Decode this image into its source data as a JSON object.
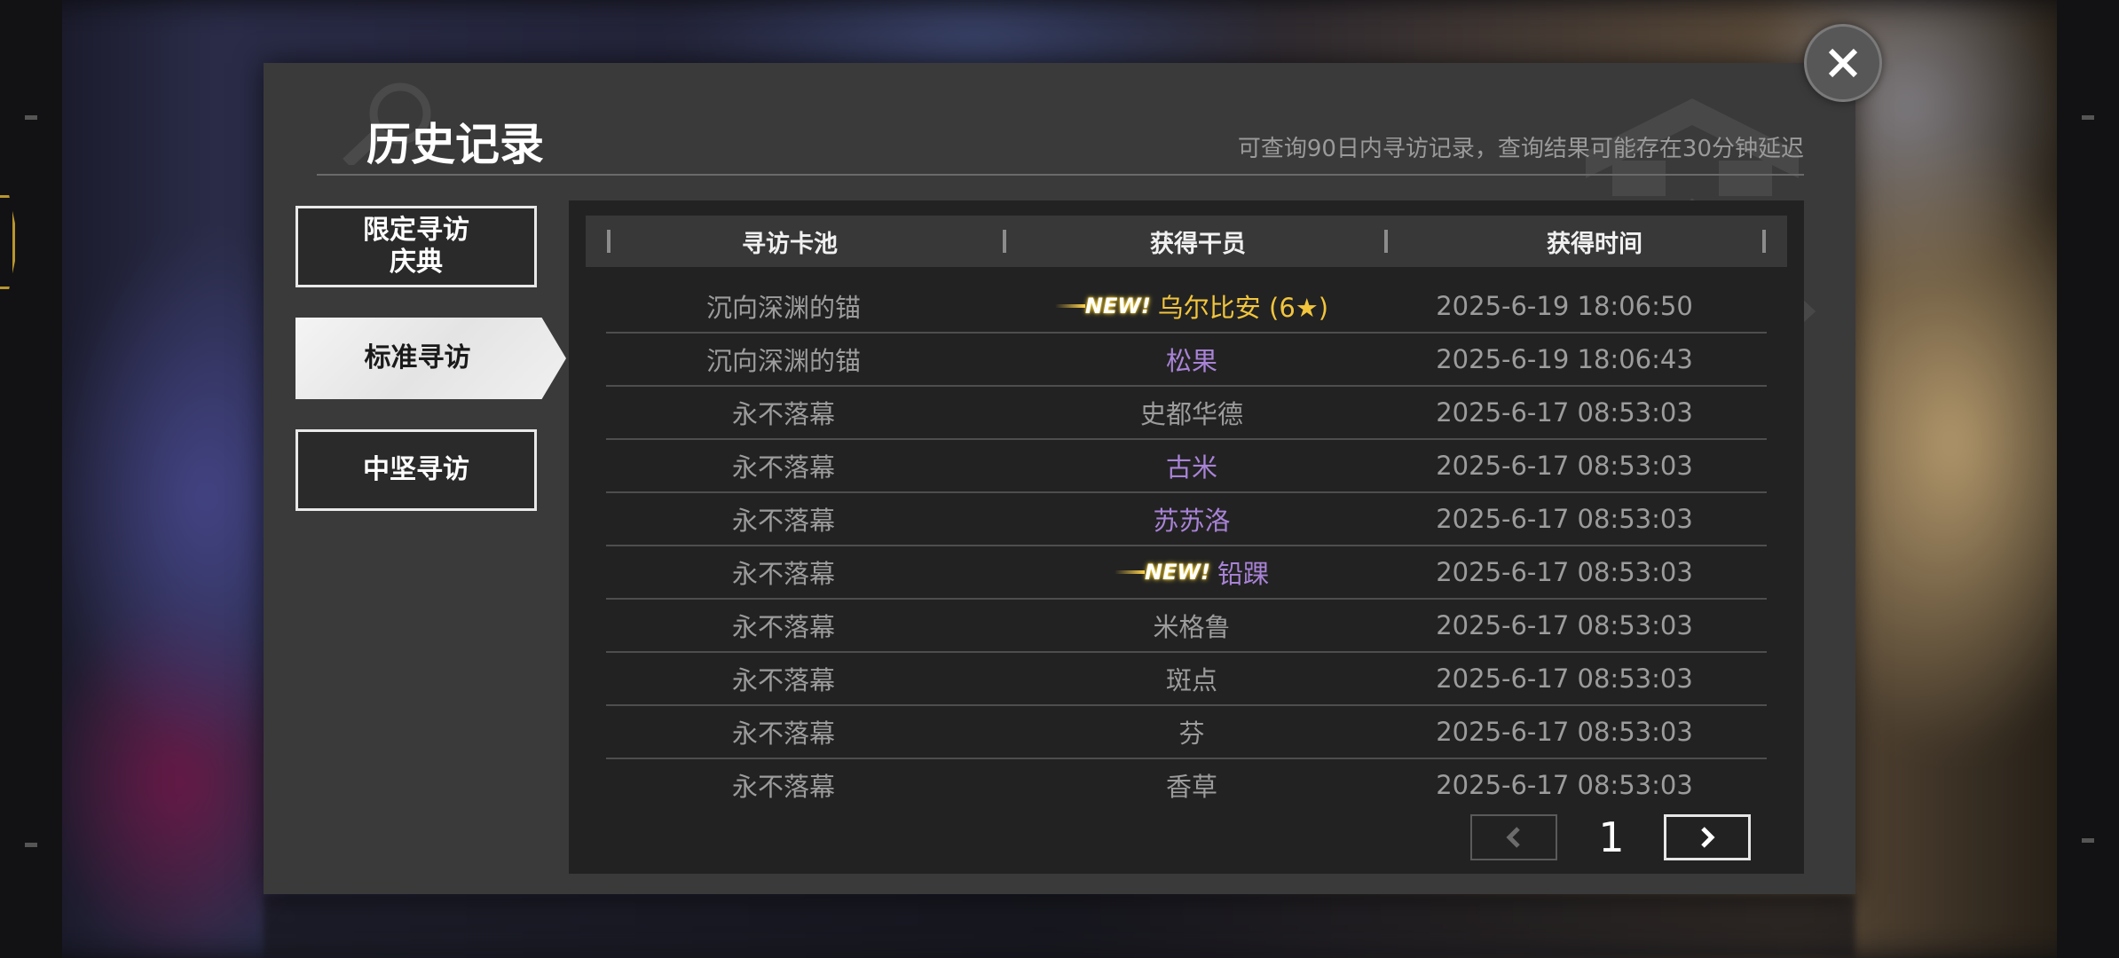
{
  "dialog": {
    "title": "历史记录",
    "subtitle": "可查询90日内寻访记录，查询结果可能存在30分钟延迟"
  },
  "tabs": [
    {
      "label": "限定寻访\n庆典",
      "active": false
    },
    {
      "label": "标准寻访",
      "active": true
    },
    {
      "label": "中坚寻访",
      "active": false
    }
  ],
  "table": {
    "headers": [
      "寻访卡池",
      "获得干员",
      "获得时间"
    ],
    "rows": [
      {
        "pool": "沉向深渊的锚",
        "operator": "乌尔比安 (6★)",
        "time": "2025-6-19 18:06:50",
        "new": true,
        "rarity": "six",
        "color": "#f2c53d"
      },
      {
        "pool": "沉向深渊的锚",
        "operator": "松果",
        "time": "2025-6-19 18:06:43",
        "new": false,
        "rarity": "four",
        "color": "#a883d6"
      },
      {
        "pool": "永不落幕",
        "operator": "史都华德",
        "time": "2025-6-17 08:53:03",
        "new": false,
        "rarity": "three",
        "color": "#9c9c9c"
      },
      {
        "pool": "永不落幕",
        "operator": "古米",
        "time": "2025-6-17 08:53:03",
        "new": false,
        "rarity": "four",
        "color": "#a883d6"
      },
      {
        "pool": "永不落幕",
        "operator": "苏苏洛",
        "time": "2025-6-17 08:53:03",
        "new": false,
        "rarity": "four",
        "color": "#a883d6"
      },
      {
        "pool": "永不落幕",
        "operator": "铅踝",
        "time": "2025-6-17 08:53:03",
        "new": true,
        "rarity": "four",
        "color": "#a883d6"
      },
      {
        "pool": "永不落幕",
        "operator": "米格鲁",
        "time": "2025-6-17 08:53:03",
        "new": false,
        "rarity": "three",
        "color": "#9c9c9c"
      },
      {
        "pool": "永不落幕",
        "operator": "斑点",
        "time": "2025-6-17 08:53:03",
        "new": false,
        "rarity": "three",
        "color": "#9c9c9c"
      },
      {
        "pool": "永不落幕",
        "operator": "芬",
        "time": "2025-6-17 08:53:03",
        "new": false,
        "rarity": "three",
        "color": "#9c9c9c"
      },
      {
        "pool": "永不落幕",
        "operator": "香草",
        "time": "2025-6-17 08:53:03",
        "new": false,
        "rarity": "three",
        "color": "#9c9c9c"
      }
    ],
    "new_badge_label": "NEW!"
  },
  "pagination": {
    "current_page": "1",
    "prev_icon": "chevron-left-icon",
    "next_icon": "chevron-right-icon"
  },
  "colors": {
    "six_star": "#f2c53d",
    "four_star": "#a883d6",
    "three_star": "#9c9c9c",
    "panel_bg": "#3a3a3a",
    "table_bg": "#222222"
  },
  "close_icon": "close-icon"
}
